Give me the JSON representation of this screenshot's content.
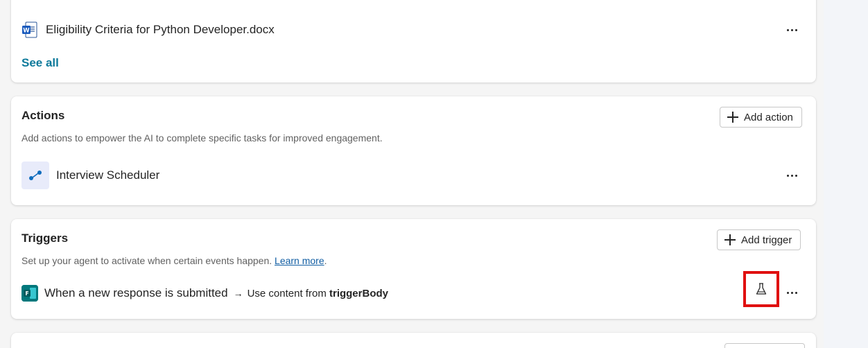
{
  "knowledge": {
    "file_name": "Eligibility Criteria for Python Developer.docx",
    "see_all": "See all"
  },
  "actions": {
    "title": "Actions",
    "add_label": "Add action",
    "description": "Add actions to empower the AI to complete specific tasks for improved engagement.",
    "items": [
      {
        "label": "Interview Scheduler",
        "icon": "flow-icon"
      }
    ]
  },
  "triggers": {
    "title": "Triggers",
    "add_label": "Add trigger",
    "description": "Set up your agent to activate when certain events happen.",
    "learn_more": "Learn more",
    "period": ".",
    "items": [
      {
        "label": "When a new response is submitted",
        "arrow": "→",
        "content_prefix": "Use content from",
        "content_value": "triggerBody",
        "icon": "forms-icon",
        "test_icon": "flask-icon"
      }
    ]
  },
  "colors": {
    "accent_link": "#0e7a9b",
    "highlight_box": "#e01010",
    "forms_brand": "#03787c",
    "word_brand": "#185abd"
  }
}
